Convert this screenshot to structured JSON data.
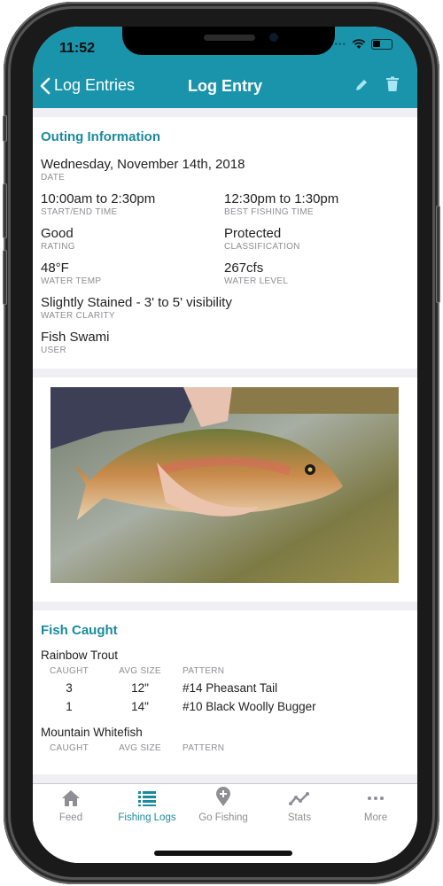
{
  "status_bar": {
    "time": "11:52"
  },
  "nav": {
    "back_label": "Log Entries",
    "title": "Log Entry",
    "edit_icon": "pencil-icon",
    "delete_icon": "trash-icon"
  },
  "outing": {
    "title": "Outing Information",
    "date": {
      "value": "Wednesday, November 14th, 2018",
      "label": "DATE"
    },
    "start_end": {
      "value": "10:00am to 2:30pm",
      "label": "START/END TIME"
    },
    "best_time": {
      "value": "12:30pm to 1:30pm",
      "label": "BEST FISHING TIME"
    },
    "rating": {
      "value": "Good",
      "label": "RATING"
    },
    "classification": {
      "value": "Protected",
      "label": "CLASSIFICATION"
    },
    "water_temp": {
      "value": "48°F",
      "label": "WATER TEMP"
    },
    "water_level": {
      "value": "267cfs",
      "label": "WATER LEVEL"
    },
    "water_clarity": {
      "value": "Slightly Stained - 3' to 5' visibility",
      "label": "WATER CLARITY"
    },
    "user": {
      "value": "Fish Swami",
      "label": "USER"
    }
  },
  "photo": {
    "description": "Hand holding a rainbow trout over river water"
  },
  "fish_caught": {
    "title": "Fish Caught",
    "columns": [
      "CAUGHT",
      "AVG SIZE",
      "PATTERN"
    ],
    "species": [
      {
        "name": "Rainbow Trout",
        "rows": [
          {
            "caught": "3",
            "avg_size": "12\"",
            "pattern": "#14 Pheasant Tail"
          },
          {
            "caught": "1",
            "avg_size": "14\"",
            "pattern": "#10 Black Woolly Bugger"
          }
        ]
      },
      {
        "name": "Mountain Whitefish",
        "rows": []
      }
    ]
  },
  "tabs": [
    {
      "label": "Feed",
      "icon": "home-icon"
    },
    {
      "label": "Fishing Logs",
      "icon": "list-icon",
      "active": true
    },
    {
      "label": "Go Fishing",
      "icon": "map-pin-plus-icon"
    },
    {
      "label": "Stats",
      "icon": "line-chart-icon"
    },
    {
      "label": "More",
      "icon": "more-icon"
    }
  ],
  "colors": {
    "brand": "#1a94ab",
    "accent_text": "#1a8a9e",
    "inactive": "#8e8e93"
  }
}
